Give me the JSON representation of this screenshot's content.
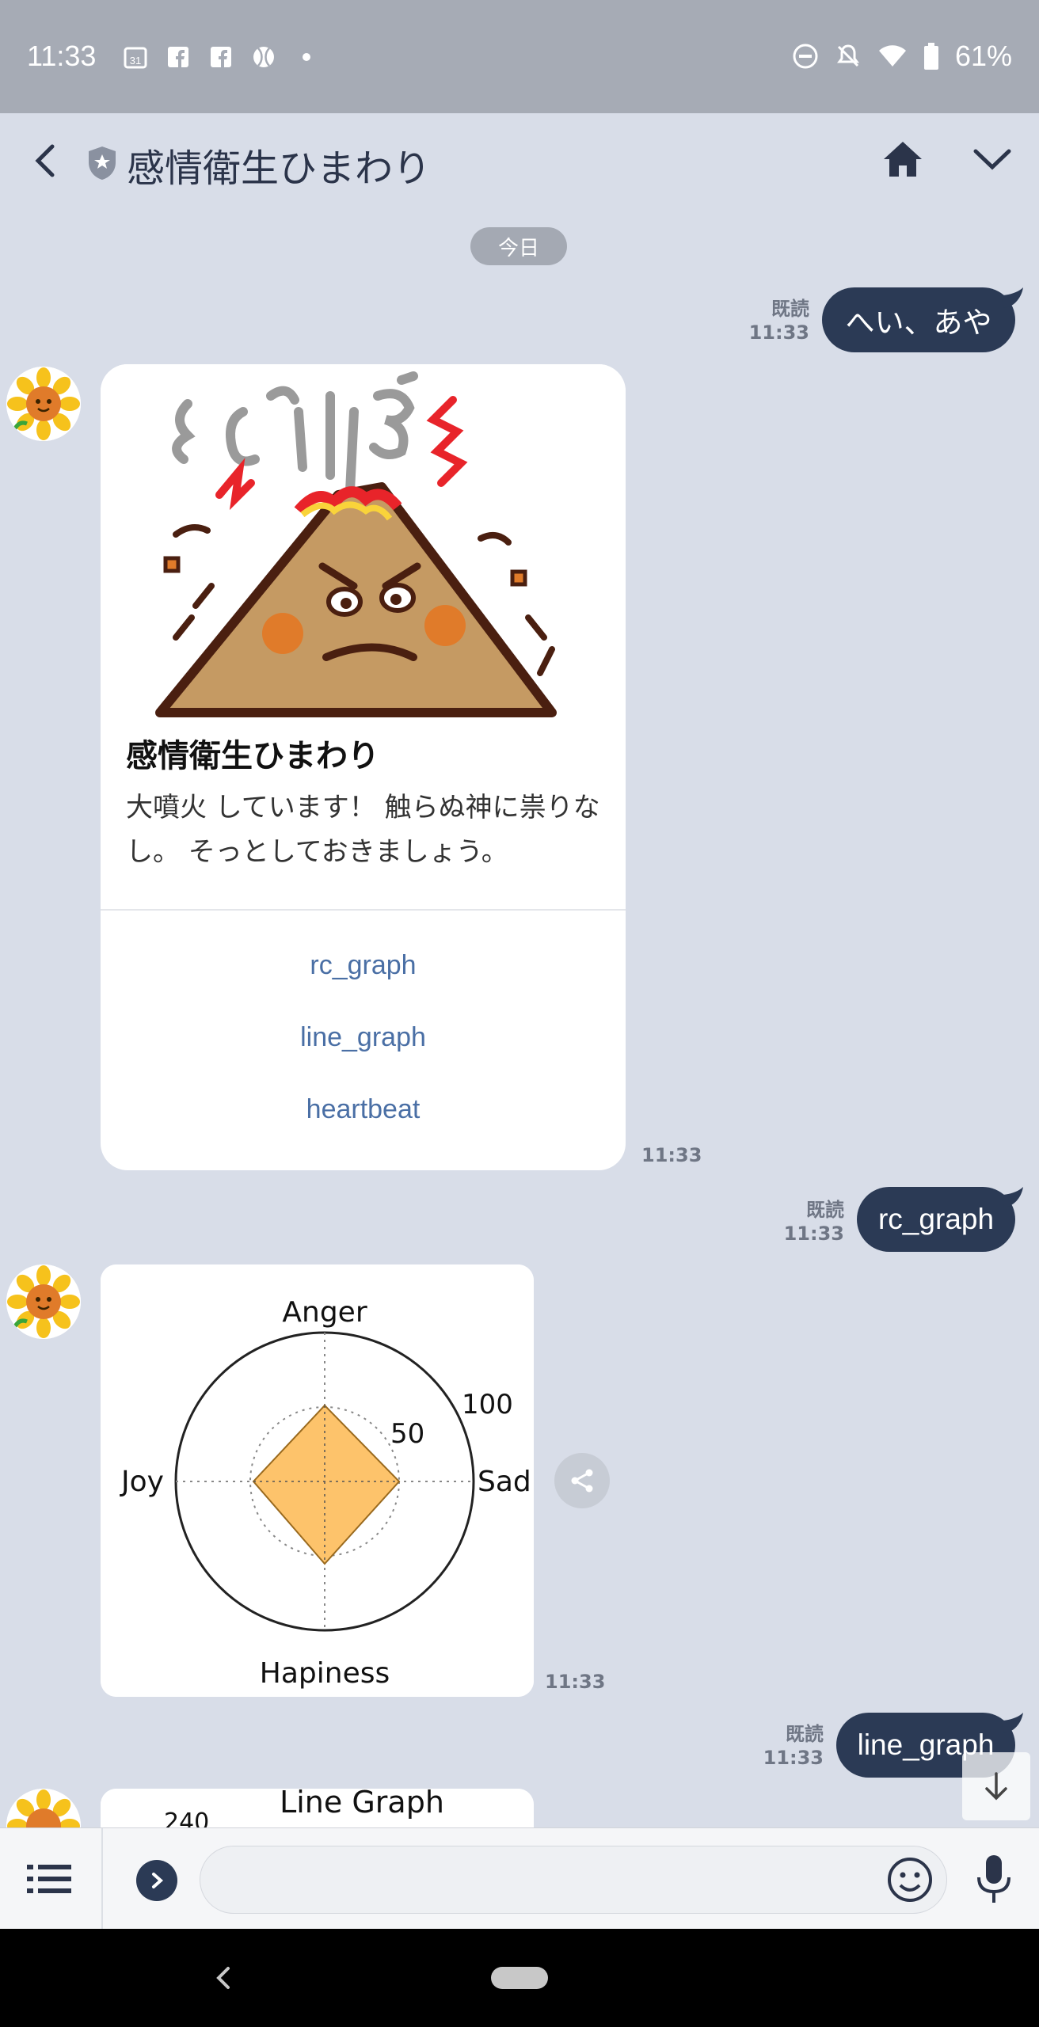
{
  "status_bar": {
    "time": "11:33",
    "battery": "61%",
    "icons_left": [
      "calendar-icon",
      "facebook-icon",
      "facebook-icon",
      "ball-icon",
      "dot-icon"
    ],
    "icons_right": [
      "dnd-icon",
      "bell-off-icon",
      "wifi-icon",
      "battery-icon"
    ]
  },
  "header": {
    "title": "感情衛生ひまわり"
  },
  "chat": {
    "date_label": "今日",
    "messages": [
      {
        "type": "outgoing",
        "read_label": "既読",
        "time": "11:33",
        "text": "へい、あや"
      },
      {
        "type": "card",
        "title": "感情衛生ひまわり",
        "body": "大噴火 しています！ 触らぬ神に祟りなし。 そっとしておきましょう。",
        "actions": [
          "rc_graph",
          "line_graph",
          "heartbeat"
        ],
        "time": "11:33"
      },
      {
        "type": "outgoing",
        "read_label": "既読",
        "time": "11:33",
        "text": "rc_graph"
      },
      {
        "type": "image",
        "time": "11:33",
        "radar": {
          "labels": {
            "top": "Anger",
            "left": "Joy",
            "right": "Sad",
            "bottom": "Hapiness"
          },
          "ticks": [
            "50",
            "100"
          ]
        }
      },
      {
        "type": "outgoing",
        "read_label": "既読",
        "time": "11:33",
        "text": "line_graph"
      },
      {
        "type": "image",
        "partial_title": "Line Graph",
        "partial_tick": "240"
      }
    ]
  },
  "colors": {
    "background": "#d8dde8",
    "status_bar": "#a6abb5",
    "outgoing_bubble": "#2b3a55",
    "action_link": "#4a6fa5"
  }
}
